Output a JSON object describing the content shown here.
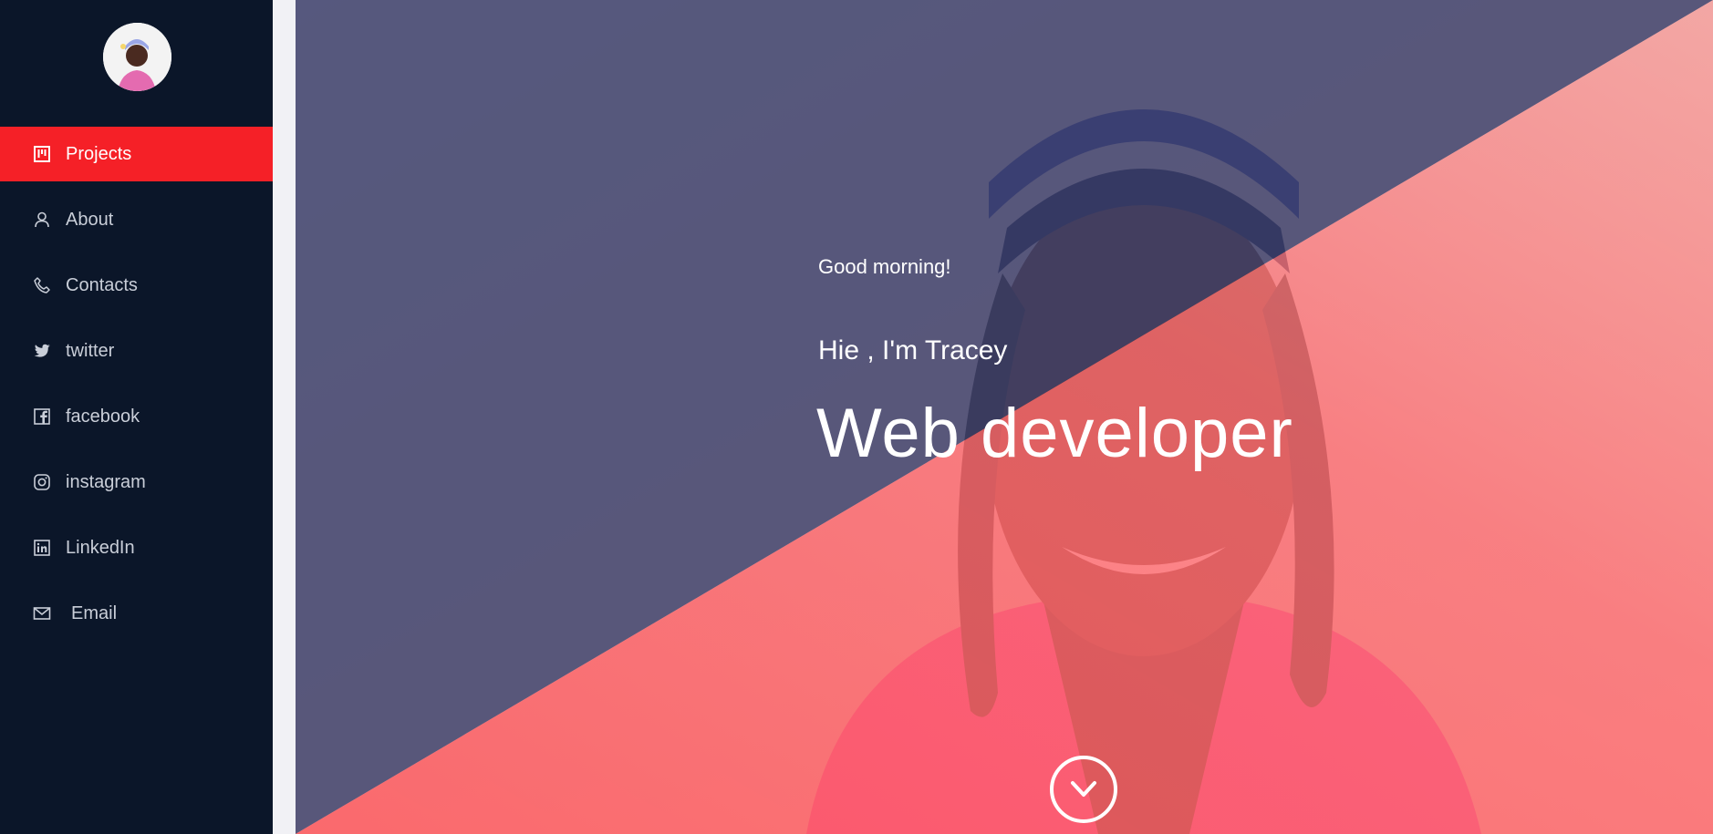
{
  "profile": {
    "avatar_alt": "Tracey profile photo"
  },
  "sidebar": {
    "items": [
      {
        "label": "Projects",
        "icon": "board-icon",
        "active": true
      },
      {
        "label": "About",
        "icon": "user-icon",
        "active": false
      },
      {
        "label": "Contacts",
        "icon": "phone-icon",
        "active": false
      },
      {
        "label": "twitter",
        "icon": "twitter-icon",
        "active": false
      },
      {
        "label": "facebook",
        "icon": "facebook-icon",
        "active": false
      },
      {
        "label": "instagram",
        "icon": "instagram-icon",
        "active": false
      },
      {
        "label": "LinkedIn",
        "icon": "linkedin-icon",
        "active": false
      },
      {
        "label": "Email",
        "icon": "mail-icon",
        "active": false
      }
    ]
  },
  "hero": {
    "greeting": "Good morning!",
    "intro": "Hie , I'm Tracey",
    "role": "Web developer",
    "scroll_icon": "chevron-down-icon"
  },
  "colors": {
    "sidebar_bg": "#0b1629",
    "active_item": "#f52027",
    "overlay_top": "#3b3f6b",
    "overlay_bottom": "#ff6a72"
  }
}
